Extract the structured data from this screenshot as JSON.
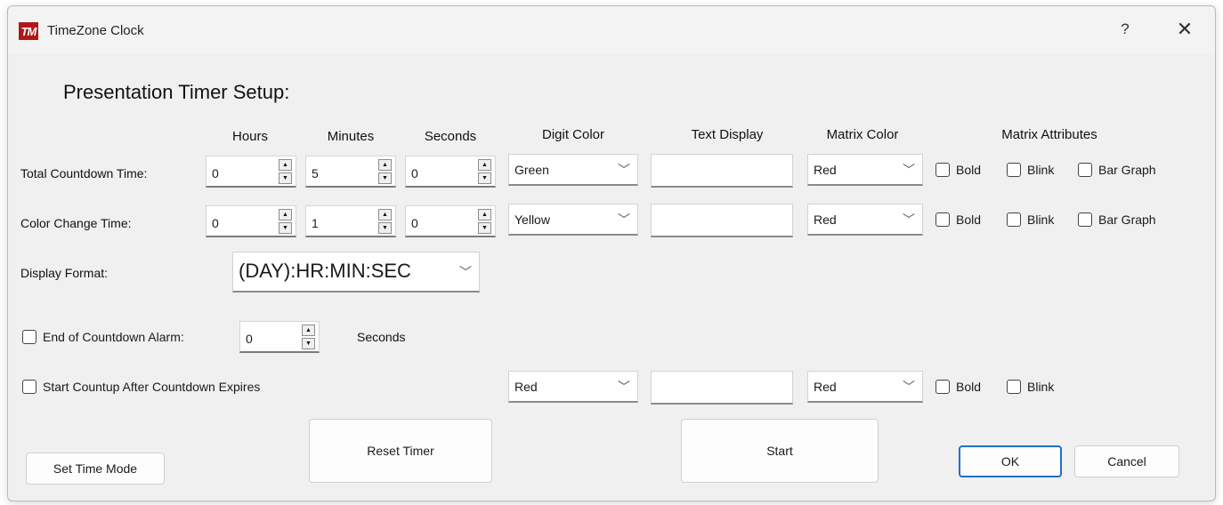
{
  "window": {
    "title": "TimeZone Clock",
    "icon_text": "TM",
    "help": "?",
    "close": "✕"
  },
  "section_title": "Presentation Timer Setup:",
  "headers": {
    "hours": "Hours",
    "minutes": "Minutes",
    "seconds": "Seconds",
    "digit_color": "Digit Color",
    "text_display": "Text Display",
    "matrix_color": "Matrix Color",
    "matrix_attributes": "Matrix Attributes"
  },
  "rows": {
    "total": {
      "label": "Total Countdown Time:",
      "hours": "0",
      "minutes": "5",
      "seconds": "0",
      "digit_color": "Green",
      "text_display": "",
      "matrix_color": "Red",
      "bold": "Bold",
      "blink": "Blink",
      "bar_graph": "Bar Graph"
    },
    "change": {
      "label": "Color Change Time:",
      "hours": "0",
      "minutes": "1",
      "seconds": "0",
      "digit_color": "Yellow",
      "text_display": "",
      "matrix_color": "Red",
      "bold": "Bold",
      "blink": "Blink",
      "bar_graph": "Bar Graph"
    }
  },
  "display_format": {
    "label": "Display Format:",
    "value": "(DAY):HR:MIN:SEC"
  },
  "alarm": {
    "label": "End of Countdown Alarm:",
    "value": "0",
    "unit": "Seconds"
  },
  "countup": {
    "label": "Start Countup After Countdown Expires",
    "digit_color": "Red",
    "text_display": "",
    "matrix_color": "Red",
    "bold": "Bold",
    "blink": "Blink"
  },
  "buttons": {
    "set_time_mode": "Set Time Mode",
    "reset_timer": "Reset Timer",
    "start": "Start",
    "ok": "OK",
    "cancel": "Cancel"
  },
  "icons": {
    "spin_up": "▲",
    "spin_down": "▼",
    "dropdown": "﹀"
  }
}
